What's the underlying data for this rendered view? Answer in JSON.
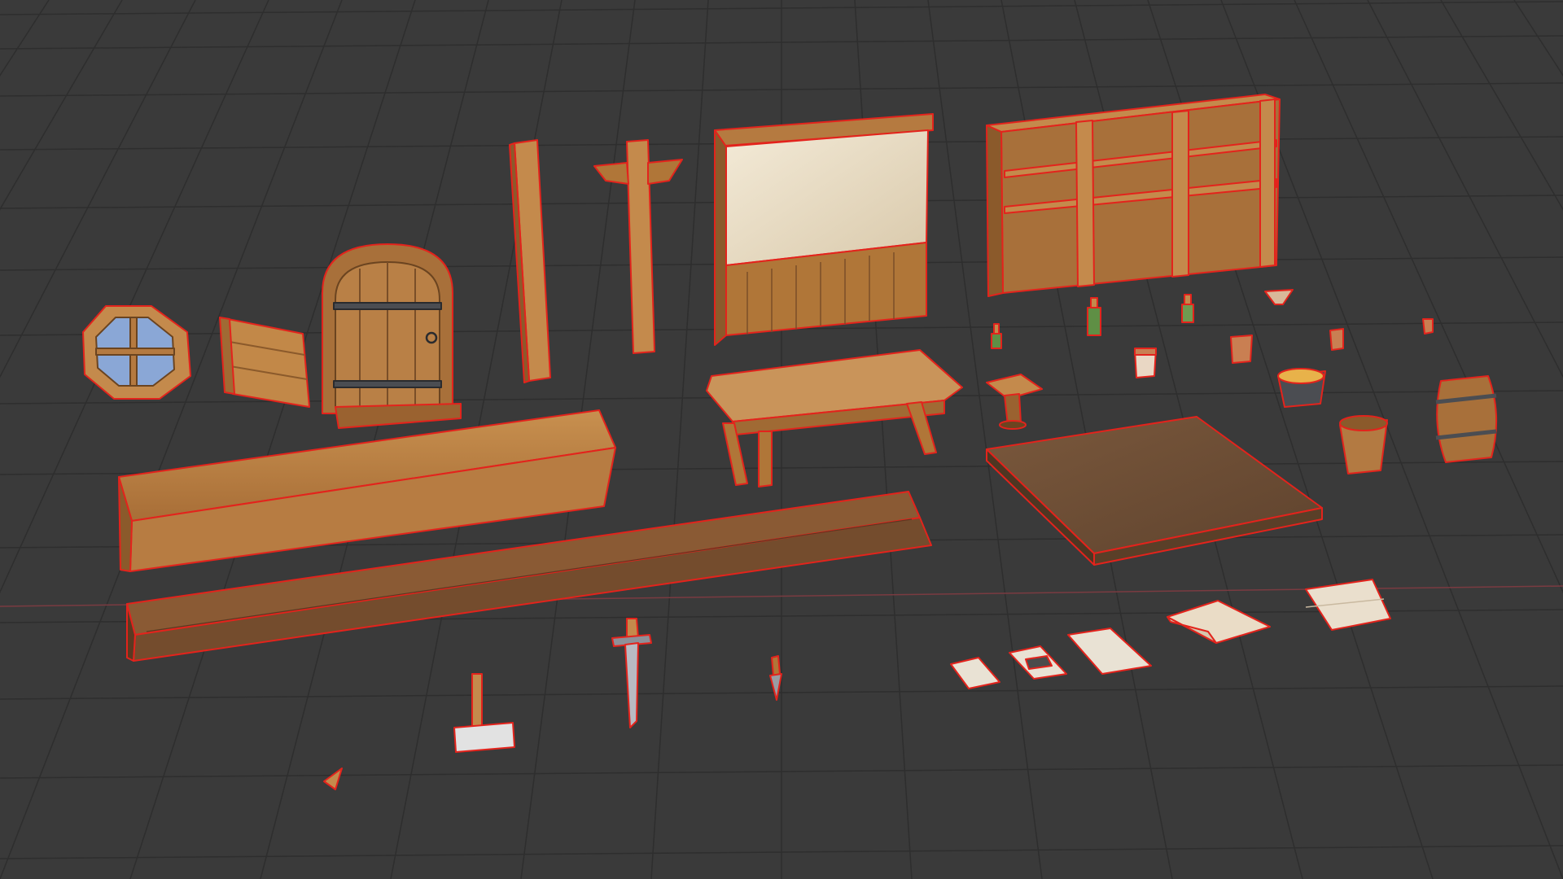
{
  "viewport": {
    "background": "#3a3a3a",
    "grid_color": "#2e2e2e",
    "x_axis_color": "#8a3f45",
    "selection_outline": "#e3231c"
  },
  "colors": {
    "wood_light": "#c48a4c",
    "wood_mid": "#a8703a",
    "wood_dark": "#7a4e28",
    "wood_floor": "#6b4c34",
    "plaster": "#efe4cf",
    "paper": "#e9e2d4",
    "iron": "#4b4d52",
    "steel": "#9a9ca3",
    "glass_green": "#5f8f45",
    "window_blue": "#8aa7d6"
  },
  "objects": [
    {
      "name": "round-window"
    },
    {
      "name": "shutter"
    },
    {
      "name": "arched-door"
    },
    {
      "name": "wooden-beam"
    },
    {
      "name": "support-post"
    },
    {
      "name": "plaster-wall-panel"
    },
    {
      "name": "bookshelf"
    },
    {
      "name": "bar-counter"
    },
    {
      "name": "wooden-step"
    },
    {
      "name": "bench-table"
    },
    {
      "name": "stool"
    },
    {
      "name": "floor-tile"
    },
    {
      "name": "bottle"
    },
    {
      "name": "mug"
    },
    {
      "name": "bowl"
    },
    {
      "name": "cooking-pot"
    },
    {
      "name": "bucket"
    },
    {
      "name": "barrel"
    },
    {
      "name": "hammer"
    },
    {
      "name": "sword"
    },
    {
      "name": "dagger"
    },
    {
      "name": "arrowhead"
    },
    {
      "name": "paper-note"
    },
    {
      "name": "wanted-poster"
    },
    {
      "name": "folded-map"
    }
  ]
}
